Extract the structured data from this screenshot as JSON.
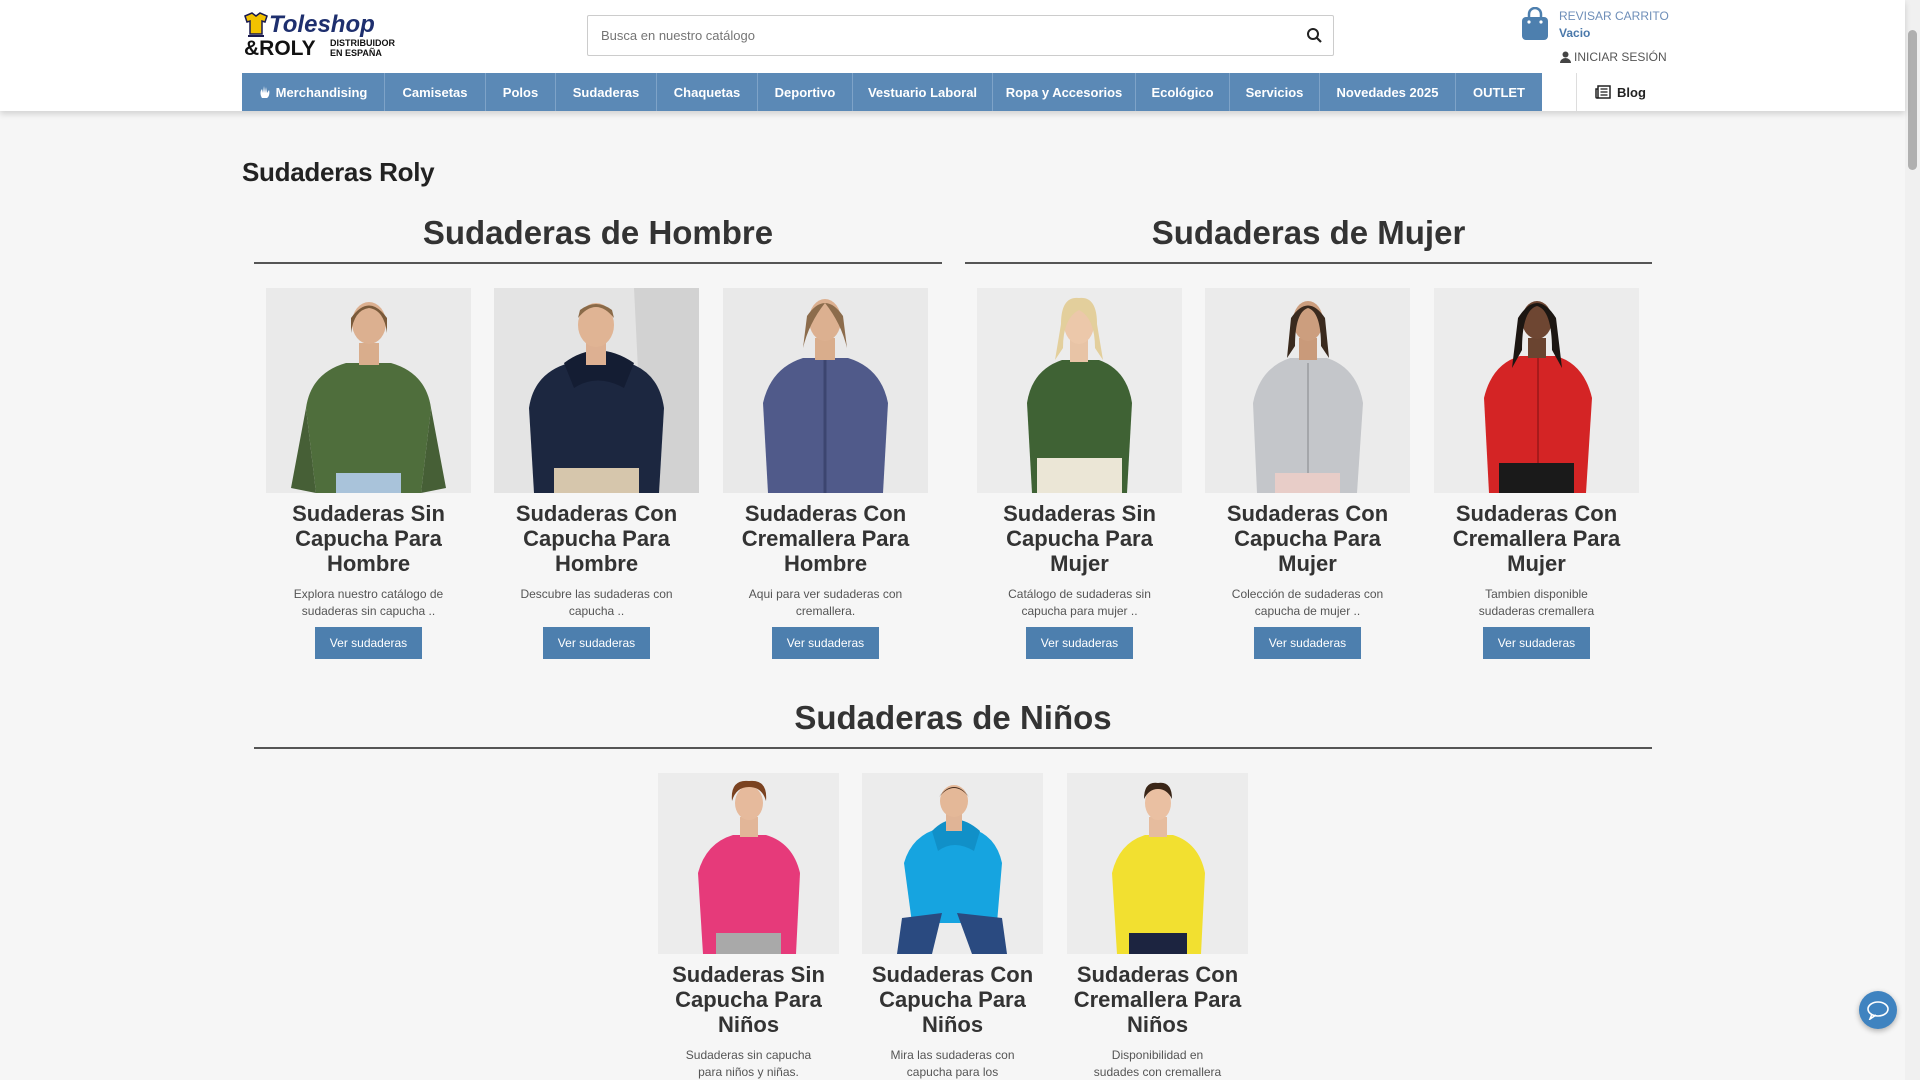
{
  "header": {
    "logo": {
      "line1": "Toleshop",
      "line2": "&ROLY",
      "line3": "DISTRIBUIDOR",
      "line4": "EN ESPAÑA"
    },
    "search_placeholder": "Busca en nuestro catálogo",
    "cart": {
      "label": "REVISAR CARRITO",
      "status": "Vacio"
    },
    "login_label": "INICIAR SESIÓN"
  },
  "nav": {
    "items": [
      {
        "label": "Merchandising",
        "icon": "merch-icon"
      },
      {
        "label": "Camisetas"
      },
      {
        "label": "Polos"
      },
      {
        "label": "Sudaderas"
      },
      {
        "label": "Chaquetas"
      },
      {
        "label": "Deportivo"
      },
      {
        "label": "Vestuario Laboral"
      },
      {
        "label": "Ropa y Accesorios"
      },
      {
        "label": "Ecológico"
      },
      {
        "label": "Servicios"
      },
      {
        "label": "Novedades 2025"
      },
      {
        "label": "OUTLET"
      }
    ],
    "blog_label": "Blog",
    "color": "#5b89b6"
  },
  "main": {
    "page_title": "Sudaderas Roly",
    "sections": {
      "hombre": {
        "title": "Sudaderas de Hombre",
        "cards": [
          {
            "title": "Sudaderas Sin Capucha Para Hombre",
            "desc": "Explora nuestro catálogo de sudaderas sin capucha ..",
            "button": "Ver sudaderas"
          },
          {
            "title": "Sudaderas Con Capucha Para Hombre",
            "desc": "Descubre las sudaderas con capucha ..",
            "button": "Ver sudaderas"
          },
          {
            "title": "Sudaderas Con Cremallera Para Hombre",
            "desc": "Aqui para ver sudaderas con cremallera.",
            "button": "Ver sudaderas"
          }
        ]
      },
      "mujer": {
        "title": "Sudaderas de Mujer",
        "cards": [
          {
            "title": "Sudaderas Sin Capucha Para Mujer",
            "desc": "Catálogo de sudaderas sin capucha para mujer ..",
            "button": "Ver sudaderas"
          },
          {
            "title": "Sudaderas Con Capucha Para Mujer",
            "desc": "Colección de sudaderas con capucha de mujer ..",
            "button": "Ver sudaderas"
          },
          {
            "title": "Sudaderas Con Cremallera Para Mujer",
            "desc": "Tambien disponible sudaderas cremallera",
            "button": "Ver sudaderas"
          }
        ]
      },
      "ninos": {
        "title": "Sudaderas de Niños",
        "cards": [
          {
            "title": "Sudaderas Sin Capucha Para Niños",
            "desc": "Sudaderas sin capucha para niños y niñas."
          },
          {
            "title": "Sudaderas Con Capucha Para Niños",
            "desc": "Mira las sudaderas con capucha para los peques."
          },
          {
            "title": "Sudaderas Con Cremallera Para Niños",
            "desc": "Disponibilidad en sudades con cremallera para niños"
          }
        ]
      }
    }
  },
  "colors": {
    "accent": "#4d7fae",
    "link": "#6e8eb8"
  }
}
